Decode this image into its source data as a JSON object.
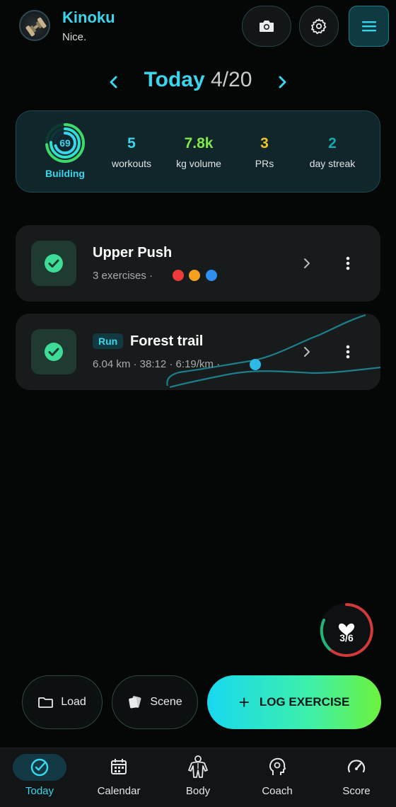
{
  "header": {
    "app_name": "Kinoku",
    "tagline": "Nice.",
    "icons": [
      "camera-icon",
      "gear-icon",
      "menu-icon"
    ]
  },
  "date": {
    "today_label": "Today",
    "date_value": "4/20"
  },
  "summary": {
    "ring_value": "69",
    "ring_label": "Building",
    "stats": [
      {
        "value": "5",
        "label": "workouts",
        "color": "#3ad6ee"
      },
      {
        "value": "7.8k",
        "label": "kg volume",
        "color": "#7fe84a"
      },
      {
        "value": "3",
        "label": "PRs",
        "color": "#f2c229"
      },
      {
        "value": "2",
        "label": "day streak",
        "color": "#1aa7b0"
      }
    ]
  },
  "workouts": [
    {
      "title": "Upper Push",
      "subtitle": "3 exercises  ·",
      "dot_colors": [
        "#ef3a3a",
        "#f5a01c",
        "#2f8ef0"
      ]
    },
    {
      "badge": "Run",
      "title": "Forest trail",
      "subtitle": "6.04 km · 38:12 · 6:19/km  ·"
    }
  ],
  "health": {
    "count": "3/6"
  },
  "actions": {
    "load_label": "Load",
    "scene_label": "Scene",
    "log_label": "LOG EXERCISE"
  },
  "tabs": [
    {
      "label": "Today",
      "icon": "check-circle-icon",
      "active": true
    },
    {
      "label": "Calendar",
      "icon": "calendar-icon",
      "active": false
    },
    {
      "label": "Body",
      "icon": "body-icon",
      "active": false
    },
    {
      "label": "Coach",
      "icon": "coach-head-icon",
      "active": false
    },
    {
      "label": "Score",
      "icon": "gauge-icon",
      "active": false
    }
  ],
  "colors": {
    "accent": "#3ad6ee",
    "success": "#3ddc97",
    "card": "#181b1c"
  }
}
